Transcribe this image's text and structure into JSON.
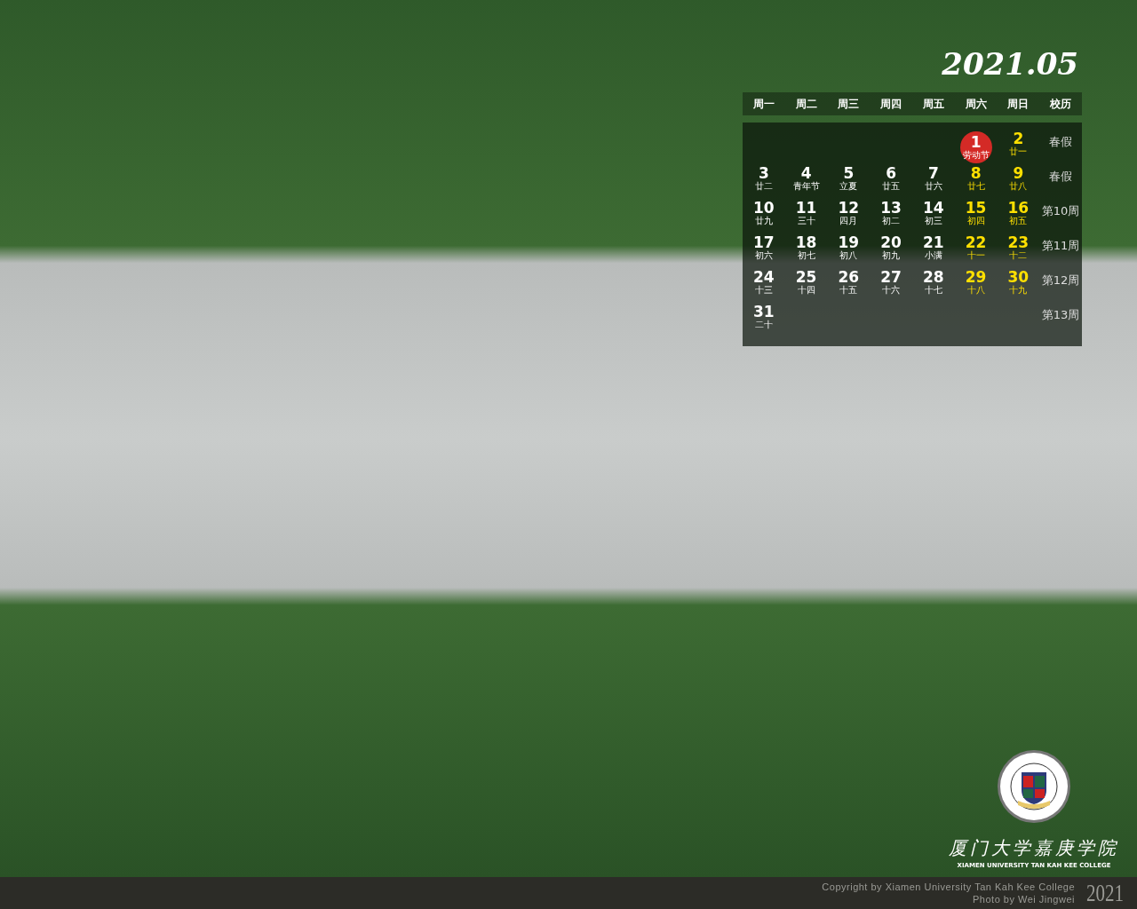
{
  "calendar": {
    "title": "2021.05",
    "headers": [
      "周一",
      "周二",
      "周三",
      "周四",
      "周五",
      "周六",
      "周日",
      "校历"
    ],
    "weeks": [
      {
        "label": "春假",
        "blank_before": true,
        "days": [
          {
            "day": "1",
            "sub": "劳动节",
            "kind": "holiday"
          },
          {
            "day": "2",
            "sub": "廿一",
            "kind": "weekend"
          }
        ]
      },
      {
        "label": "春假",
        "days": [
          {
            "day": "3",
            "sub": "廿二",
            "kind": "weekday"
          },
          {
            "day": "4",
            "sub": "青年节",
            "kind": "weekday"
          },
          {
            "day": "5",
            "sub": "立夏",
            "kind": "weekday"
          },
          {
            "day": "6",
            "sub": "廿五",
            "kind": "weekday"
          },
          {
            "day": "7",
            "sub": "廿六",
            "kind": "weekday"
          },
          {
            "day": "8",
            "sub": "廿七",
            "kind": "weekend"
          },
          {
            "day": "9",
            "sub": "廿八",
            "kind": "weekend"
          }
        ]
      },
      {
        "label": "第10周",
        "days": [
          {
            "day": "10",
            "sub": "廿九",
            "kind": "weekday"
          },
          {
            "day": "11",
            "sub": "三十",
            "kind": "weekday"
          },
          {
            "day": "12",
            "sub": "四月",
            "kind": "weekday"
          },
          {
            "day": "13",
            "sub": "初二",
            "kind": "weekday"
          },
          {
            "day": "14",
            "sub": "初三",
            "kind": "weekday"
          },
          {
            "day": "15",
            "sub": "初四",
            "kind": "weekend"
          },
          {
            "day": "16",
            "sub": "初五",
            "kind": "weekend"
          }
        ]
      },
      {
        "label": "第11周",
        "days": [
          {
            "day": "17",
            "sub": "初六",
            "kind": "weekday"
          },
          {
            "day": "18",
            "sub": "初七",
            "kind": "weekday"
          },
          {
            "day": "19",
            "sub": "初八",
            "kind": "weekday"
          },
          {
            "day": "20",
            "sub": "初九",
            "kind": "weekday"
          },
          {
            "day": "21",
            "sub": "小满",
            "kind": "weekday"
          },
          {
            "day": "22",
            "sub": "十一",
            "kind": "weekend"
          },
          {
            "day": "23",
            "sub": "十二",
            "kind": "weekend"
          }
        ]
      },
      {
        "label": "第12周",
        "days": [
          {
            "day": "24",
            "sub": "十三",
            "kind": "weekday"
          },
          {
            "day": "25",
            "sub": "十四",
            "kind": "weekday"
          },
          {
            "day": "26",
            "sub": "十五",
            "kind": "weekday"
          },
          {
            "day": "27",
            "sub": "十六",
            "kind": "weekday"
          },
          {
            "day": "28",
            "sub": "十七",
            "kind": "weekday"
          },
          {
            "day": "29",
            "sub": "十八",
            "kind": "weekend"
          },
          {
            "day": "30",
            "sub": "十九",
            "kind": "weekend"
          }
        ]
      },
      {
        "label": "第13周",
        "blank_before": false,
        "days": [
          {
            "day": "31",
            "sub": "二十",
            "kind": "weekday"
          }
        ]
      }
    ]
  },
  "brand": {
    "name_cn": "厦门大学嘉庚学院",
    "name_en": "XIAMEN UNIVERSITY TAN KAH KEE COLLEGE"
  },
  "footer": {
    "copyright": "Copyright by Xiamen University Tan Kah Kee College",
    "photo_credit": "Photo by Wei Jingwei",
    "year": "2021"
  }
}
